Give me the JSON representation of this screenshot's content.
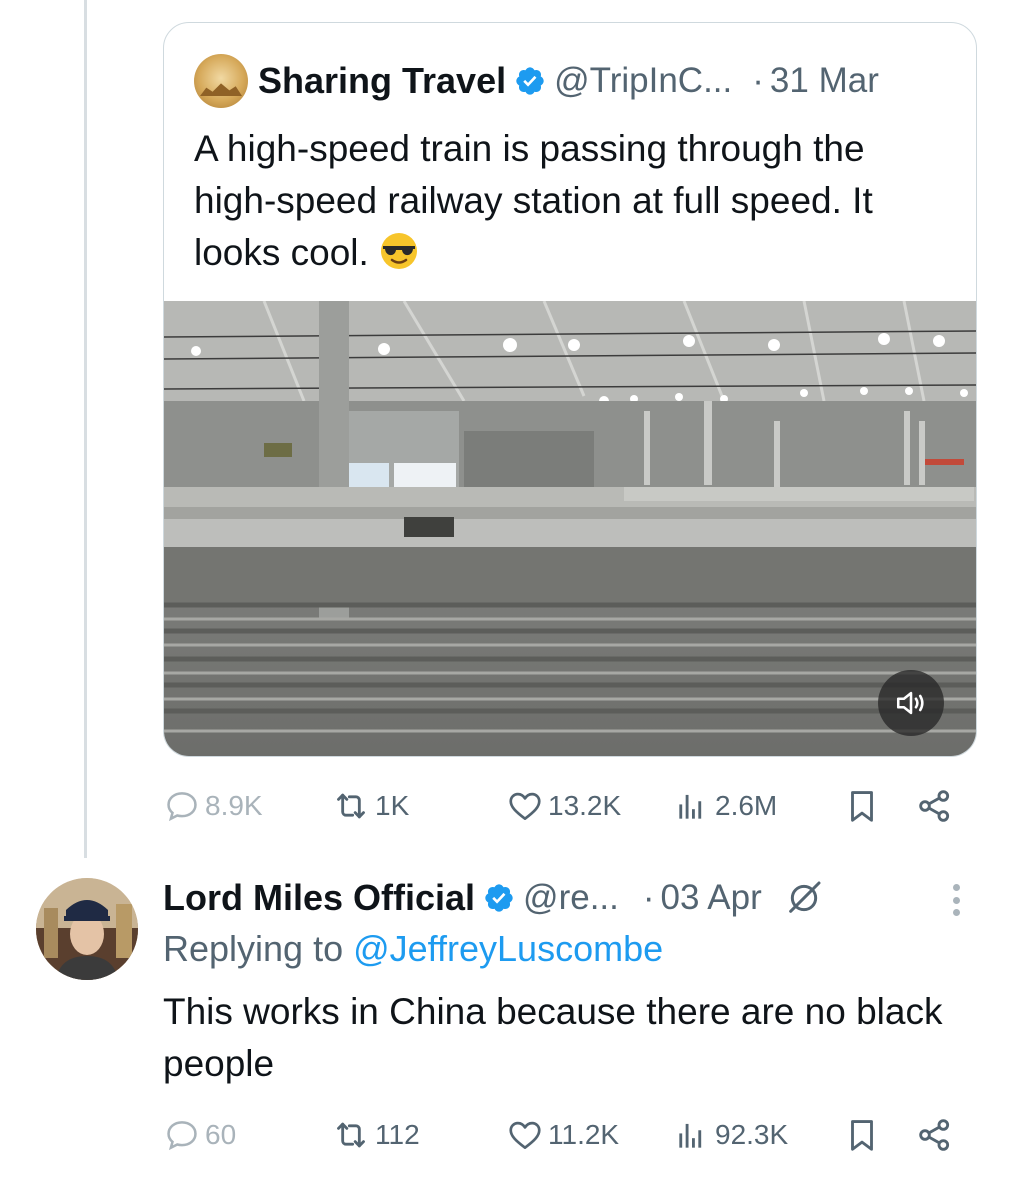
{
  "quoted_tweet": {
    "author_name": "Sharing Travel",
    "handle": "@TripInC...",
    "separator": "·",
    "date": "31 Mar",
    "text": "A high-speed train is passing through the high-speed railway station at full speed. It looks cool.",
    "stats": {
      "replies": "8.9K",
      "retweets": "1K",
      "likes": "13.2K",
      "views": "2.6M"
    }
  },
  "reply_tweet": {
    "author_name": "Lord Miles Official",
    "handle": "@re...",
    "separator": "·",
    "date": "03 Apr",
    "replying_prefix": "Replying to ",
    "replying_to": "@JeffreyLuscombe",
    "text": "This works in China because there are no black people",
    "stats": {
      "replies": "60",
      "retweets": "112",
      "likes": "11.2K",
      "views": "92.3K"
    }
  },
  "icons": {
    "verified": "verified-badge-icon",
    "emoji": "sunglasses-emoji",
    "mute": "speaker-muted-icon",
    "reply": "speech-bubble-icon",
    "retweet": "retweet-icon",
    "like": "heart-icon",
    "views": "bar-chart-icon",
    "bookmark": "bookmark-icon",
    "share": "share-icon",
    "grok": "grok-icon",
    "more": "vertical-dots-icon"
  },
  "colors": {
    "accent": "#1d9bf0",
    "secondary_text": "#536471",
    "primary_text": "#0f1419",
    "border": "#cfd9de"
  }
}
